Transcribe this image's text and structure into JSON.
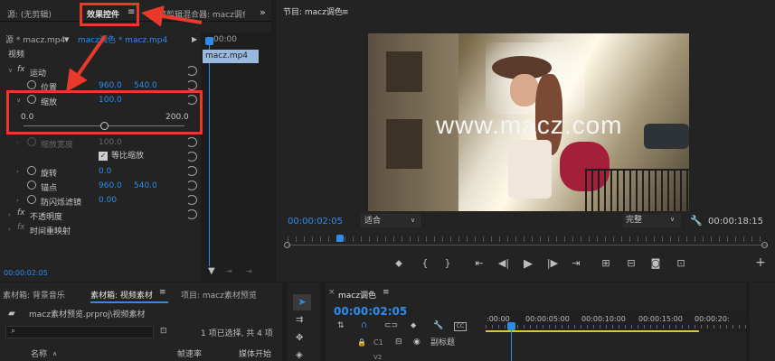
{
  "source_panel": {
    "tab_source": "源: (无剪辑)",
    "tab_effects": "效果控件",
    "tab_mixer": "音频剪辑混合器: macz调色",
    "clip_source": "源 * macz.mp4",
    "clip_seq": "macz调色 * macz.mp4",
    "mini_timecode": "00:00",
    "mini_clip": "macz.mp4",
    "section_video": "视频",
    "motion": "运动",
    "position": {
      "label": "位置",
      "x": "960.0",
      "y": "540.0"
    },
    "scale": {
      "label": "缩放",
      "value": "100.0",
      "min": "0.0",
      "max": "200.0",
      "slider_fraction": 0.5
    },
    "scale_width": {
      "label": "缩放宽度",
      "value": "100.0"
    },
    "uniform_scale": "等比缩放",
    "rotation": {
      "label": "旋转",
      "value": "0.0"
    },
    "anchor": {
      "label": "锚点",
      "x": "960.0",
      "y": "540.0"
    },
    "anti_flicker": {
      "label": "防闪烁滤镜",
      "value": "0.00"
    },
    "opacity": "不透明度",
    "time_remap": "时间重映射",
    "bottom_timecode": "00:00:02:05"
  },
  "program": {
    "title": "节目: macz调色",
    "watermark": "www.macz.com",
    "current_time": "00:00:02:05",
    "fit": "适合",
    "quality": "完整",
    "duration": "00:00:18:15"
  },
  "project": {
    "tab_bin1": "素材箱: 背景音乐",
    "tab_bin2": "素材箱: 视频素材",
    "tab_project": "项目: macz素材预览",
    "path": "macz素材预览.prproj\\视频素材",
    "selection": "1 项已选择, 共 4 项",
    "col_name": "名称",
    "col_fps": "帧速率",
    "col_start": "媒体开始"
  },
  "timeline": {
    "tab": "macz调色",
    "timecode": "00:00:02:05",
    "ruler": [
      ":00:00",
      "00:00:05:00",
      "00:00:10:00",
      "00:00:15:00",
      "00:00:20:"
    ],
    "track_c1": "C1",
    "track_caption": "副标题",
    "track_v2": "V2"
  }
}
